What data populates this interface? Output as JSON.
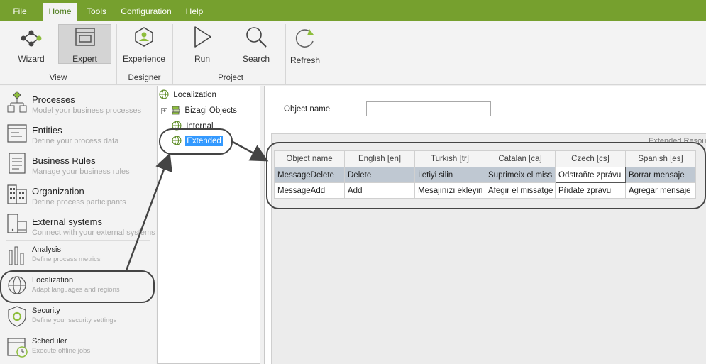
{
  "menu": {
    "items": [
      "File",
      "Home",
      "Tools",
      "Configuration",
      "Help"
    ],
    "active": "Home"
  },
  "ribbon": {
    "buttons": {
      "wizard": "Wizard",
      "expert": "Expert",
      "experience": "Experience",
      "run": "Run",
      "search": "Search",
      "refresh": "Refresh"
    },
    "groups": {
      "view": "View",
      "designer": "Designer",
      "project": "Project"
    }
  },
  "nav": {
    "items": [
      {
        "title": "Processes",
        "subtitle": "Model your business processes"
      },
      {
        "title": "Entities",
        "subtitle": "Define your process data"
      },
      {
        "title": "Business Rules",
        "subtitle": "Manage your business rules"
      },
      {
        "title": "Organization",
        "subtitle": "Define process participants"
      },
      {
        "title": "External systems",
        "subtitle": "Connect with your external systems"
      },
      {
        "title": "Analysis",
        "subtitle": "Define process metrics"
      },
      {
        "title": "Localization",
        "subtitle": "Adapt languages and regions"
      },
      {
        "title": "Security",
        "subtitle": "Define your security settings"
      },
      {
        "title": "Scheduler",
        "subtitle": "Execute offline jobs"
      }
    ]
  },
  "tree": {
    "root": "Localization",
    "children": [
      "Bizagi Objects",
      "Internal",
      "Extended"
    ],
    "selected": "Extended"
  },
  "main": {
    "object_name_label": "Object name",
    "object_name_value": "",
    "grid_caption": "Extended Resour",
    "columns": [
      "Object name",
      "English [en]",
      "Turkish [tr]",
      "Catalan [ca]",
      "Czech [cs]",
      "Spanish [es]"
    ],
    "rows": [
      [
        "MessageDelete",
        "Delete",
        "İletiyi silin",
        "Suprimeix el miss",
        "Odstraňte zprávu",
        "Borrar mensaje"
      ],
      [
        "MessageAdd",
        "Add",
        "Mesajınızı ekleyin",
        "Afegir el missatge",
        "Přidáte zprávu",
        "Agregar mensaje"
      ]
    ]
  },
  "colors": {
    "menubar": "#76a02e",
    "accent_green": "#8dbd3c",
    "selection_blue": "#3399ff",
    "selected_row": "#bfc8d2"
  },
  "icons": {
    "wizard": "network-icon",
    "expert": "layout-icon",
    "experience": "hexagon-user-icon",
    "run": "play-icon",
    "search": "search-icon",
    "refresh": "refresh-icon"
  }
}
